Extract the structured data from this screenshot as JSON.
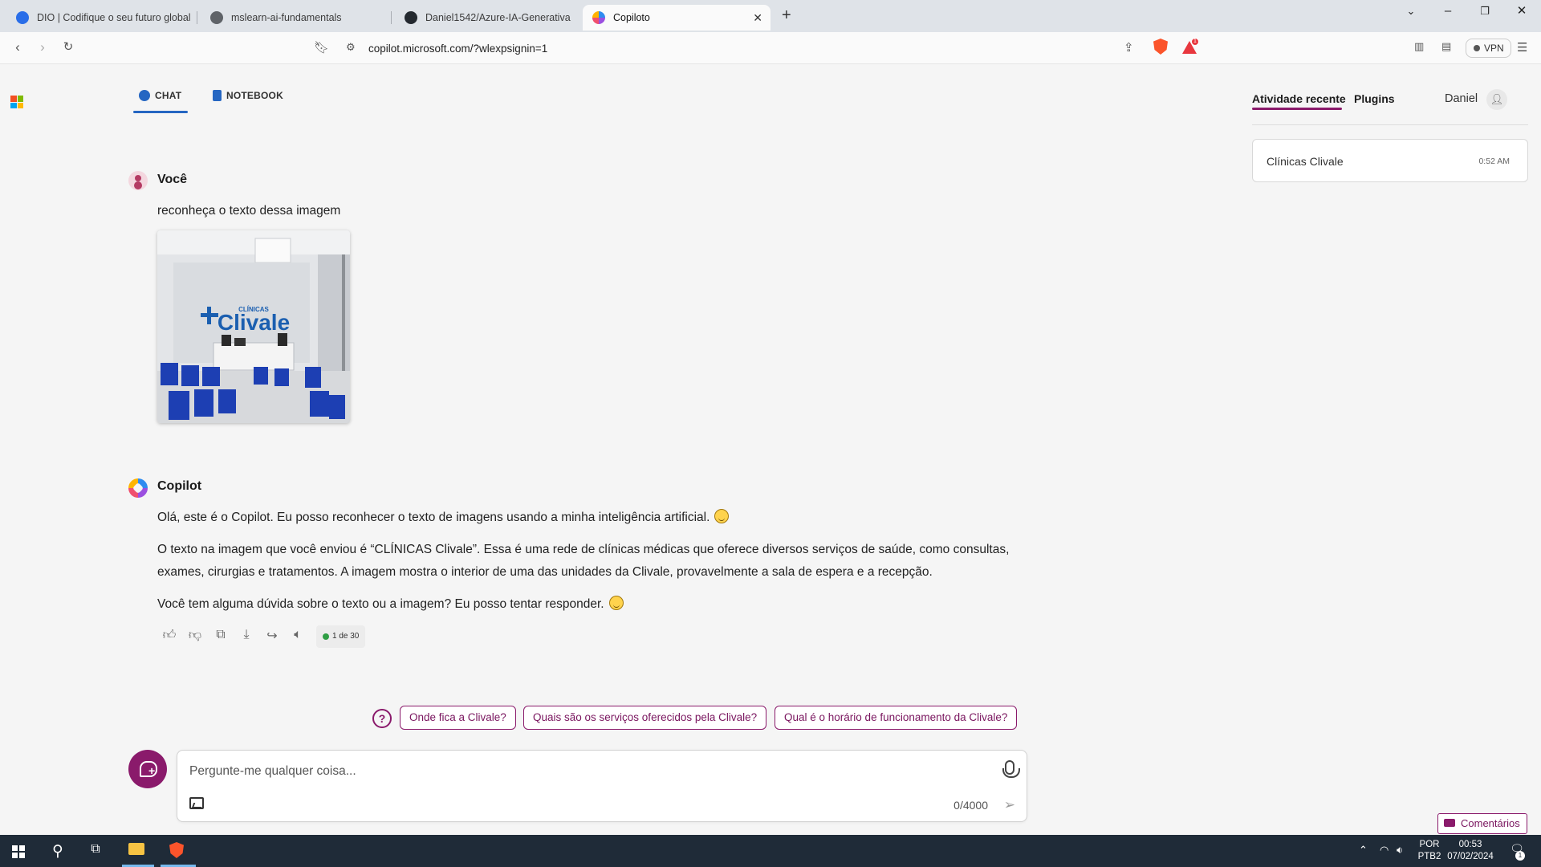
{
  "browser": {
    "tabs": [
      {
        "title": "DIO | Codifique o seu futuro global a",
        "icon": "dio-icon",
        "color": "#2a6ee8"
      },
      {
        "title": "mslearn-ai-fundamentals",
        "icon": "globe-icon",
        "color": "#5f6368"
      },
      {
        "title": "Daniel1542/Azure-IA-Generativa",
        "icon": "github-icon",
        "color": "#24292f"
      },
      {
        "title": "Copiloto",
        "icon": "copilot-icon",
        "color": "#9b4fe0"
      }
    ],
    "url": "copilot.microsoft.com/?wlexpsignin=1",
    "vpn_label": "VPN",
    "rewards_count": "1"
  },
  "modes": {
    "chat": "CHAT",
    "notebook": "NOTEBOOK"
  },
  "sidebar": {
    "recent_tab": "Atividade recente",
    "plugins_tab": "Plugins",
    "user_name": "Daniel",
    "recent_items": [
      {
        "title": "Clínicas Clivale",
        "time": "0:52 AM"
      }
    ]
  },
  "conversation": {
    "user": {
      "sender": "Você",
      "text": "reconheça o texto dessa imagem",
      "image_sign": {
        "small": "CLÍNICAS",
        "big": "Clivale"
      }
    },
    "bot": {
      "sender": "Copilot",
      "paragraph1": "Olá, este é o Copilot. Eu posso reconhecer o texto de imagens usando a minha inteligência artificial.",
      "paragraph2": "O texto na imagem que você enviou é “CLÍNICAS Clivale”. Essa é uma rede de clínicas médicas que oferece diversos serviços de saúde, como consultas, exames, cirurgias e tratamentos. A imagem mostra o interior de uma das unidades da Clivale, provavelmente a sala de espera e a recepção.",
      "paragraph3": "Você tem alguma dúvida sobre o texto ou a imagem? Eu posso tentar responder.",
      "counter": "1 de 30"
    }
  },
  "suggestions": [
    "Onde fica a Clivale?",
    "Quais são os serviços oferecidos pela Clivale?",
    "Qual é o horário de funcionamento da Clivale?"
  ],
  "composer": {
    "placeholder": "Pergunte-me qualquer coisa...",
    "char_count": "0/4000"
  },
  "feedback_label": "Comentários",
  "taskbar": {
    "lang_top": "POR",
    "lang_bottom": "PTB2",
    "time": "00:53",
    "date": "07/02/2024",
    "notifications": "1"
  },
  "colors": {
    "accent": "#8a1a6b",
    "chat_tab_accent": "#2566c2",
    "taskbar": "#1f2b38"
  }
}
